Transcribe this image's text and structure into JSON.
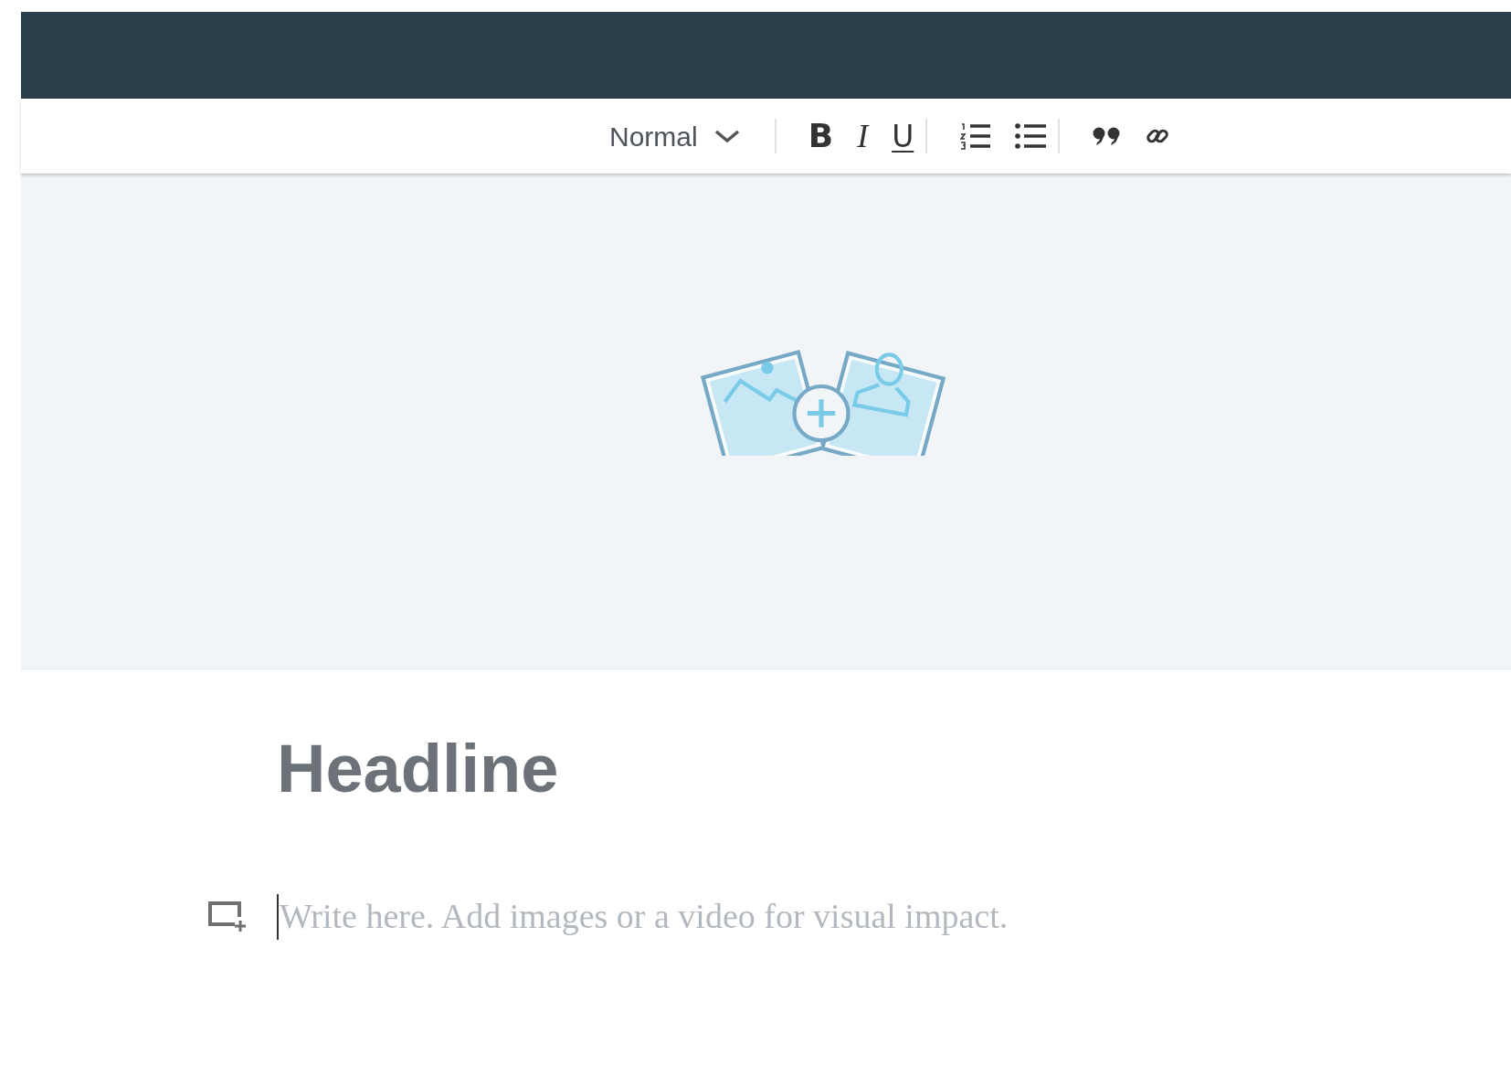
{
  "toolbar": {
    "style_select": {
      "value": "Normal"
    },
    "buttons": [
      {
        "kind": "bold",
        "label": "B"
      },
      {
        "kind": "italic",
        "label": "I"
      },
      {
        "kind": "underline",
        "label": "U"
      },
      {
        "kind": "ordered-list"
      },
      {
        "kind": "bullet-list"
      },
      {
        "kind": "quote"
      },
      {
        "kind": "link"
      }
    ]
  },
  "headline": {
    "placeholder": "Headline"
  },
  "body": {
    "placeholder": "Write here. Add images or a video for visual impact."
  }
}
